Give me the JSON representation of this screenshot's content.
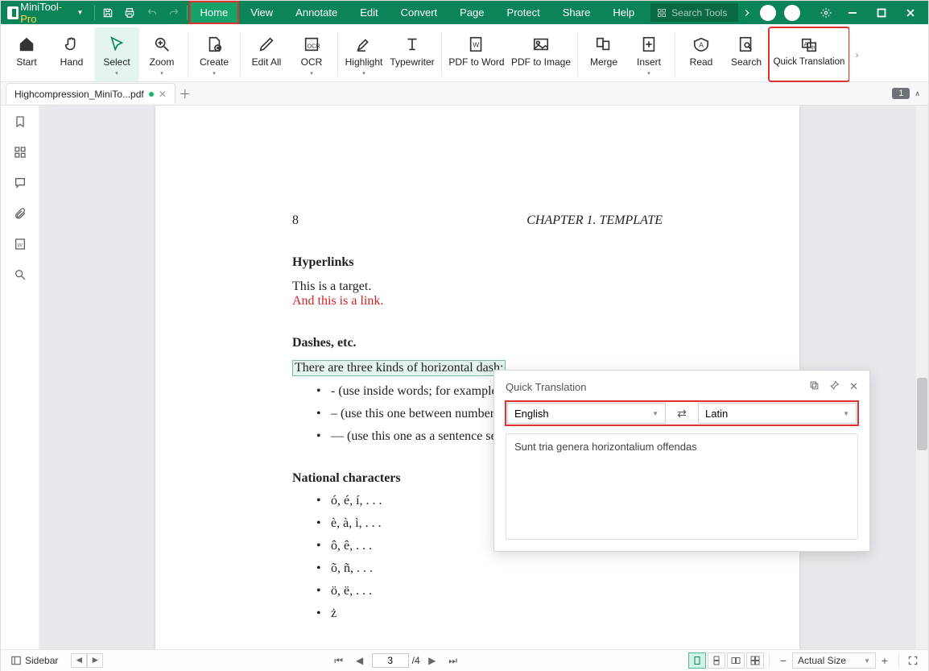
{
  "brand": {
    "name": "MiniTool",
    "suffix": "-Pro"
  },
  "menu": [
    "Home",
    "View",
    "Annotate",
    "Edit",
    "Convert",
    "Page",
    "Protect",
    "Share",
    "Help"
  ],
  "menu_active_index": 0,
  "search_placeholder": "Search Tools",
  "ribbon": [
    {
      "label": "Start",
      "dd": false
    },
    {
      "label": "Hand",
      "dd": false
    },
    {
      "label": "Select",
      "dd": true,
      "sel": true
    },
    {
      "label": "Zoom",
      "dd": true
    },
    {
      "label": "Create",
      "dd": true
    },
    {
      "label": "Edit All",
      "dd": false
    },
    {
      "label": "OCR",
      "dd": true
    },
    {
      "label": "Highlight",
      "dd": true
    },
    {
      "label": "Typewriter",
      "dd": false
    },
    {
      "label": "PDF to Word",
      "dd": false
    },
    {
      "label": "PDF to Image",
      "dd": false
    },
    {
      "label": "Merge",
      "dd": false
    },
    {
      "label": "Insert",
      "dd": true
    },
    {
      "label": "Read",
      "dd": false
    },
    {
      "label": "Search",
      "dd": false
    },
    {
      "label": "Quick Translation",
      "dd": false,
      "hl": true
    }
  ],
  "doc_tab": {
    "name": "Highcompression_MiniTo...pdf"
  },
  "page_count_badge": "1",
  "pdf": {
    "page_number": "8",
    "chapter": "CHAPTER 1.   TEMPLATE",
    "sec_hyper": "Hyperlinks",
    "target_text": "This is a target.",
    "link_text": "And this is a link.",
    "sec_dashes": "Dashes, etc.",
    "dash_intro": "There are three kinds of horizontal dash:",
    "dash_items": [
      "- (use inside words; for example “",
      "– (use this one between numbers;",
      "— (use this one as a sentence sepa"
    ],
    "sec_national": "National characters",
    "nat_items": [
      "ó, é, í, . . .",
      "è, à, ì, . . .",
      "ô, ê, . . .",
      "õ, ñ, . . .",
      "ö, ë, . . .",
      "ż"
    ]
  },
  "qt": {
    "title": "Quick Translation",
    "src": "English",
    "tgt": "Latin",
    "result": "Sunt tria genera horizontalium offendas"
  },
  "status": {
    "sidebar_label": "Sidebar",
    "page_current": "3",
    "page_total": "/4",
    "zoom_label": "Actual Size"
  }
}
